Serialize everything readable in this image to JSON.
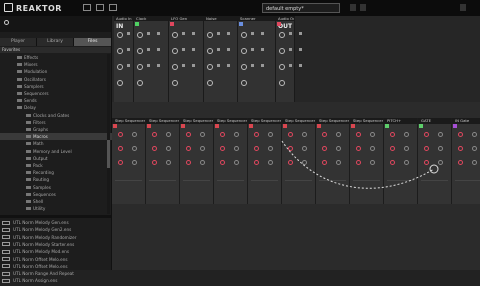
{
  "app": {
    "name": "REAKTOR",
    "document_title": "default empty*"
  },
  "sidebar": {
    "tabs": [
      {
        "label": "Player"
      },
      {
        "label": "Library"
      },
      {
        "label": "Files"
      }
    ],
    "section_label": "Favorites",
    "tree": [
      {
        "label": "Effects",
        "indent": 1
      },
      {
        "label": "Mixers",
        "indent": 1
      },
      {
        "label": "Modulation",
        "indent": 1
      },
      {
        "label": "Oscillators",
        "indent": 1
      },
      {
        "label": "Samplers",
        "indent": 1
      },
      {
        "label": "Sequencers",
        "indent": 1
      },
      {
        "label": "Sends",
        "indent": 1
      },
      {
        "label": "Delay",
        "indent": 1
      },
      {
        "label": "Clocks and Gates",
        "indent": 2
      },
      {
        "label": "Filters",
        "indent": 2
      },
      {
        "label": "Graphs",
        "indent": 2
      },
      {
        "label": "Macros",
        "indent": 2
      },
      {
        "label": "Math",
        "indent": 2
      },
      {
        "label": "Memory and Level",
        "indent": 2
      },
      {
        "label": "Output",
        "indent": 2
      },
      {
        "label": "Pack",
        "indent": 2
      },
      {
        "label": "Recording",
        "indent": 2
      },
      {
        "label": "Routing",
        "indent": 2
      },
      {
        "label": "Samples",
        "indent": 2
      },
      {
        "label": "Sequences",
        "indent": 2
      },
      {
        "label": "Shell",
        "indent": 2
      },
      {
        "label": "Utility",
        "indent": 2
      }
    ],
    "selected_index": 11,
    "files": [
      "UTL Norm Melody Gen.ens",
      "UTL Norm Melody Gen2.ens",
      "UTL Norm Melody Randomizer",
      "UTL Norm Melody Starter.ens",
      "UTL Norm Melody Mod.ens",
      "UTL Norm Offset Melo.ens",
      "UTL Norm Offset Melo.ens",
      "UTL Norm Range And Repeat",
      "UTL Norm Assign.ens"
    ]
  },
  "top_modules": [
    {
      "name": "Audio In",
      "io_label": "IN"
    },
    {
      "name": "Clock",
      "io_label": ""
    },
    {
      "name": "LFO Gen",
      "io_label": ""
    },
    {
      "name": "Noise",
      "io_label": ""
    },
    {
      "name": "Scanner",
      "io_label": ""
    },
    {
      "name": "Audio Out",
      "io_label": "OUT"
    }
  ],
  "strip_modules": [
    {
      "name": "Step Sequencer",
      "tag": "#d9464f"
    },
    {
      "name": "Step Sequencer",
      "tag": "#d9464f"
    },
    {
      "name": "Step Sequencer",
      "tag": "#d9464f"
    },
    {
      "name": "Step Sequencer",
      "tag": "#d9464f"
    },
    {
      "name": "Step Sequencer",
      "tag": "#d9464f"
    },
    {
      "name": "Step Sequencer",
      "tag": "#d9464f"
    },
    {
      "name": "Step Sequencer",
      "tag": "#d9464f"
    },
    {
      "name": "Step Sequencer",
      "tag": "#d9464f"
    },
    {
      "name": "PITCH+",
      "tag": "#5dce6a"
    },
    {
      "name": "GATE",
      "tag": "#5dce6a"
    },
    {
      "name": "IN Gate",
      "tag": "#a64fd6"
    }
  ],
  "colors": {
    "accent_red": "#e0475e",
    "accent_green": "#4fd163",
    "accent_purple": "#a64fd6"
  }
}
